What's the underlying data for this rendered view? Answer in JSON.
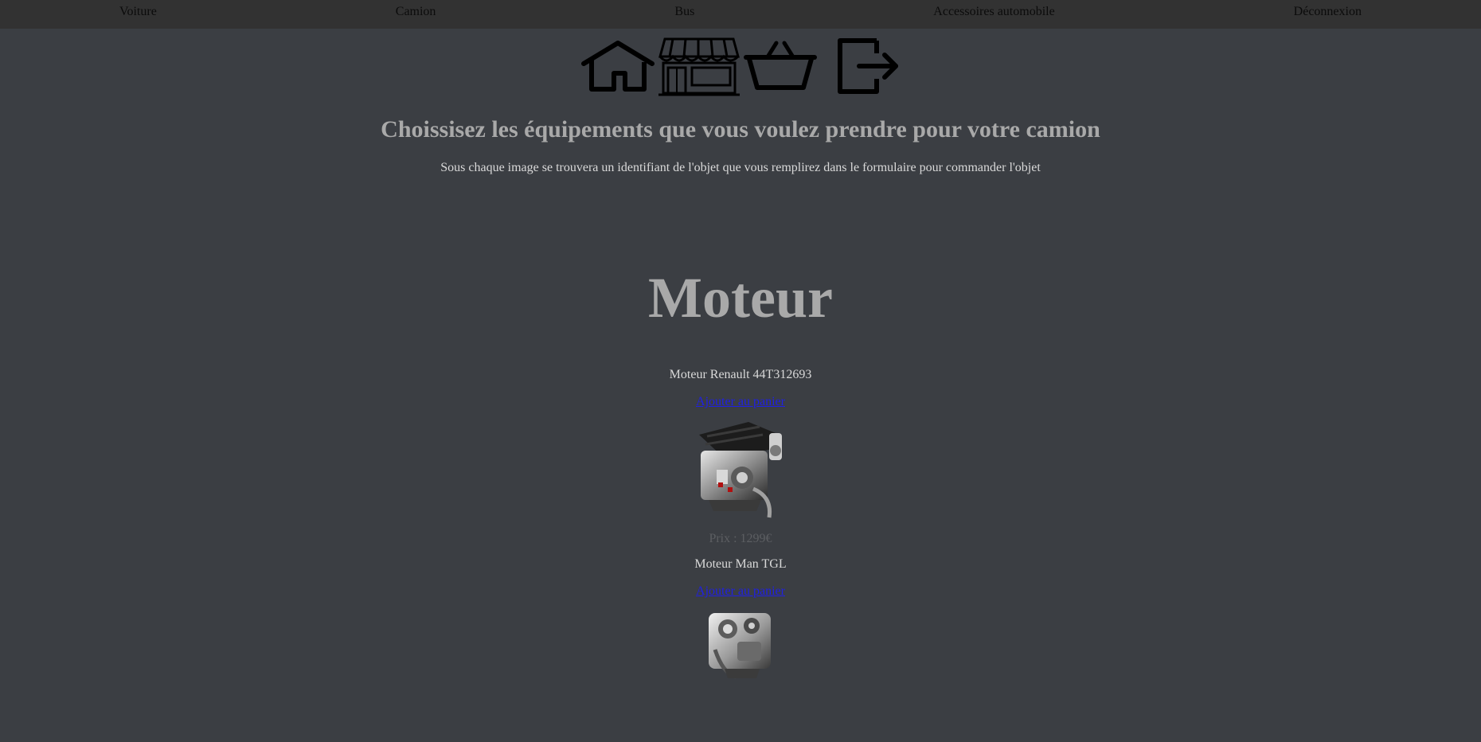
{
  "nav": {
    "items": [
      "Voiture",
      "Camion",
      "Bus",
      "Accessoires automobile",
      "Déconnexion"
    ]
  },
  "icons": [
    "home-icon",
    "shop-icon",
    "basket-icon",
    "logout-icon"
  ],
  "header": {
    "title": "Choissisez les équipements que vous voulez prendre pour votre camion",
    "subtitle": "Sous chaque image se trouvera un identifiant de l'objet que vous remplirez dans le formulaire pour commander l'objet"
  },
  "section": {
    "title": "Moteur"
  },
  "products": [
    {
      "name": "Moteur Renault 44T312693",
      "add_label": "Ajouter au panier",
      "price": "Prix : 1299€",
      "image_icon": "engine-image"
    },
    {
      "name": "Moteur Man TGL",
      "add_label": "Ajouter au panier",
      "image_icon": "engine-image"
    }
  ],
  "colors": {
    "background": "#3b3e43",
    "nav_background": "#323232",
    "link": "#1f1fe6",
    "heading": "#a9a9a9"
  }
}
